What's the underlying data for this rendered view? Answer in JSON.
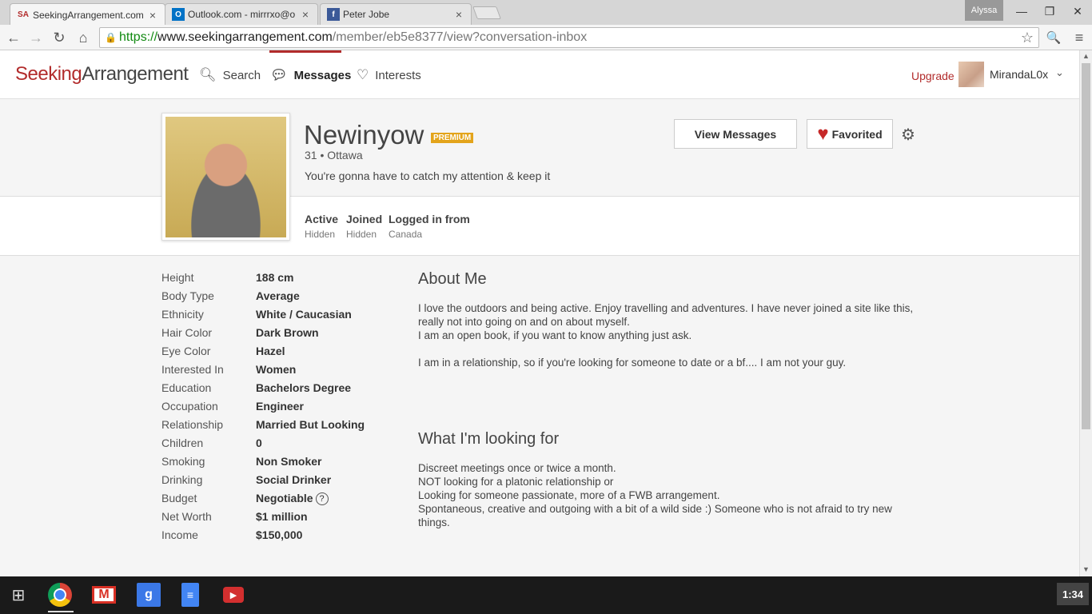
{
  "browser": {
    "tabs": [
      {
        "favicon": "SA",
        "title": "SeekingArrangement.com"
      },
      {
        "favicon": "O",
        "title": "Outlook.com - mirrrxo@o"
      },
      {
        "favicon": "f",
        "title": "Peter Jobe"
      }
    ],
    "profile_name": "Alyssa",
    "url": {
      "scheme": "https://",
      "host": "www.seekingarrangement.com",
      "path": "/member/eb5e8377/view?conversation-inbox"
    }
  },
  "site": {
    "logo": {
      "part1": "Seeking",
      "part2": "Arrangement"
    },
    "nav": {
      "search": "Search",
      "messages": "Messages",
      "interests": "Interests"
    },
    "upgrade": "Upgrade",
    "username": "MirandaL0x"
  },
  "profile": {
    "name": "Newinyow",
    "badge": "PREMIUM",
    "age": "31",
    "separator": "•",
    "location": "Ottawa",
    "headline": "You're gonna have to catch my attention & keep it",
    "buttons": {
      "view_messages": "View Messages",
      "favorited": "Favorited"
    },
    "stats": [
      {
        "label": "Active",
        "value": "Hidden"
      },
      {
        "label": "Joined",
        "value": "Hidden"
      },
      {
        "label": "Logged in from",
        "value": "Canada"
      }
    ],
    "details": [
      {
        "key": "Height",
        "value": "188 cm"
      },
      {
        "key": "Body Type",
        "value": "Average"
      },
      {
        "key": "Ethnicity",
        "value": "White / Caucasian"
      },
      {
        "key": "Hair Color",
        "value": "Dark Brown"
      },
      {
        "key": "Eye Color",
        "value": "Hazel"
      },
      {
        "key": "Interested In",
        "value": "Women"
      },
      {
        "key": "Education",
        "value": "Bachelors Degree"
      },
      {
        "key": "Occupation",
        "value": "Engineer"
      },
      {
        "key": "Relationship",
        "value": "Married But Looking"
      },
      {
        "key": "Children",
        "value": "0"
      },
      {
        "key": "Smoking",
        "value": "Non Smoker"
      },
      {
        "key": "Drinking",
        "value": "Social Drinker"
      },
      {
        "key": "Budget",
        "value": "Negotiable"
      },
      {
        "key": "Net Worth",
        "value": "$1 million"
      },
      {
        "key": "Income",
        "value": "$150,000"
      }
    ],
    "about_me": {
      "title": "About Me",
      "lines": [
        "I love the outdoors and being active. Enjoy travelling and adventures. I have never joined a site like this, really not into going on and on about myself.",
        "I am an open book, if you want to know anything just ask.",
        "",
        "I am in a relationship, so if you're looking for someone to date or a bf.... I am not your guy."
      ]
    },
    "looking_for": {
      "title": "What I'm looking for",
      "lines": [
        "Discreet meetings once or twice a month.",
        "NOT looking for a platonic relationship or",
        "Looking for someone passionate, more of a FWB arrangement.",
        "Spontaneous, creative and outgoing with a bit of a wild side :) Someone who is not afraid to try new things."
      ]
    }
  },
  "taskbar": {
    "clock": "1:34"
  },
  "colors": {
    "brand_red": "#b22c2c",
    "premium_gold": "#e3a41b"
  }
}
